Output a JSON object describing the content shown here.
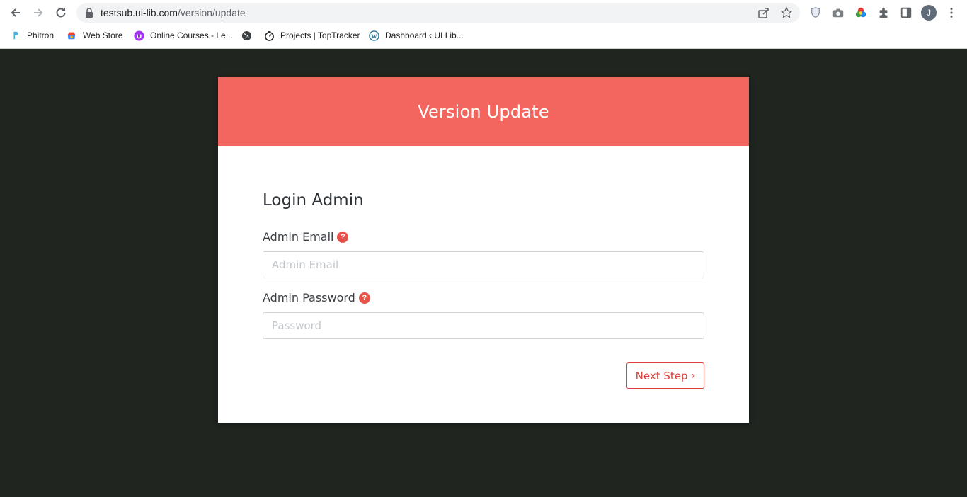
{
  "browser": {
    "url_host": "testsub.ui-lib.com",
    "url_path": "/version/update",
    "profile_initial": "J",
    "bookmarks": [
      {
        "label": "Phitron"
      },
      {
        "label": "Web Store"
      },
      {
        "label": "Online Courses - Le..."
      },
      {
        "label": ""
      },
      {
        "label": "Projects | TopTracker"
      },
      {
        "label": "Dashboard ‹ UI Lib..."
      }
    ]
  },
  "page": {
    "header_title": "Version Update",
    "section_title": "Login Admin",
    "email_label": "Admin Email",
    "email_placeholder": "Admin Email",
    "password_label": "Admin Password",
    "password_placeholder": "Password",
    "next_button_label": "Next Step",
    "help_glyph": "?",
    "next_glyph": "›"
  },
  "colors": {
    "page_background": "#202520",
    "header_accent": "#f2665f",
    "button_accent": "#d9413a"
  }
}
